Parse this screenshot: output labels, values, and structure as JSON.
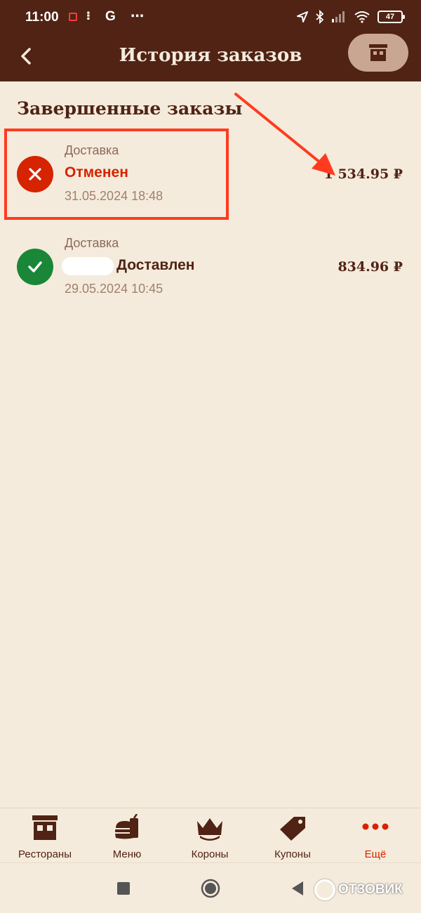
{
  "status_bar": {
    "time": "11:00",
    "g_label": "G",
    "more": "⋯",
    "battery": "47"
  },
  "header": {
    "title": "История заказов"
  },
  "section": {
    "title": "Завершенные заказы"
  },
  "orders": [
    {
      "type": "Доставка",
      "status": "Отменен",
      "date": "31.05.2024 18:48",
      "price": "1 534.95 ₽",
      "status_color": "#d62300"
    },
    {
      "type": "Доставка",
      "status": "Доставлен",
      "date": "29.05.2024 10:45",
      "price": "834.96 ₽",
      "status_color": "#198737"
    }
  ],
  "nav": [
    {
      "label": "Рестораны",
      "icon": "restaurant-icon"
    },
    {
      "label": "Меню",
      "icon": "burger-icon"
    },
    {
      "label": "Короны",
      "icon": "crown-icon"
    },
    {
      "label": "Купоны",
      "icon": "coupon-icon"
    },
    {
      "label": "Ещё",
      "icon": "more-dots-icon",
      "active": true
    }
  ],
  "watermark": {
    "text": "ОТЗОВИК"
  },
  "colors": {
    "brand_brown": "#502314",
    "background": "#f5ebdc",
    "accent_red": "#d62300",
    "success_green": "#198737",
    "annotation_red": "#ff3b1f"
  }
}
